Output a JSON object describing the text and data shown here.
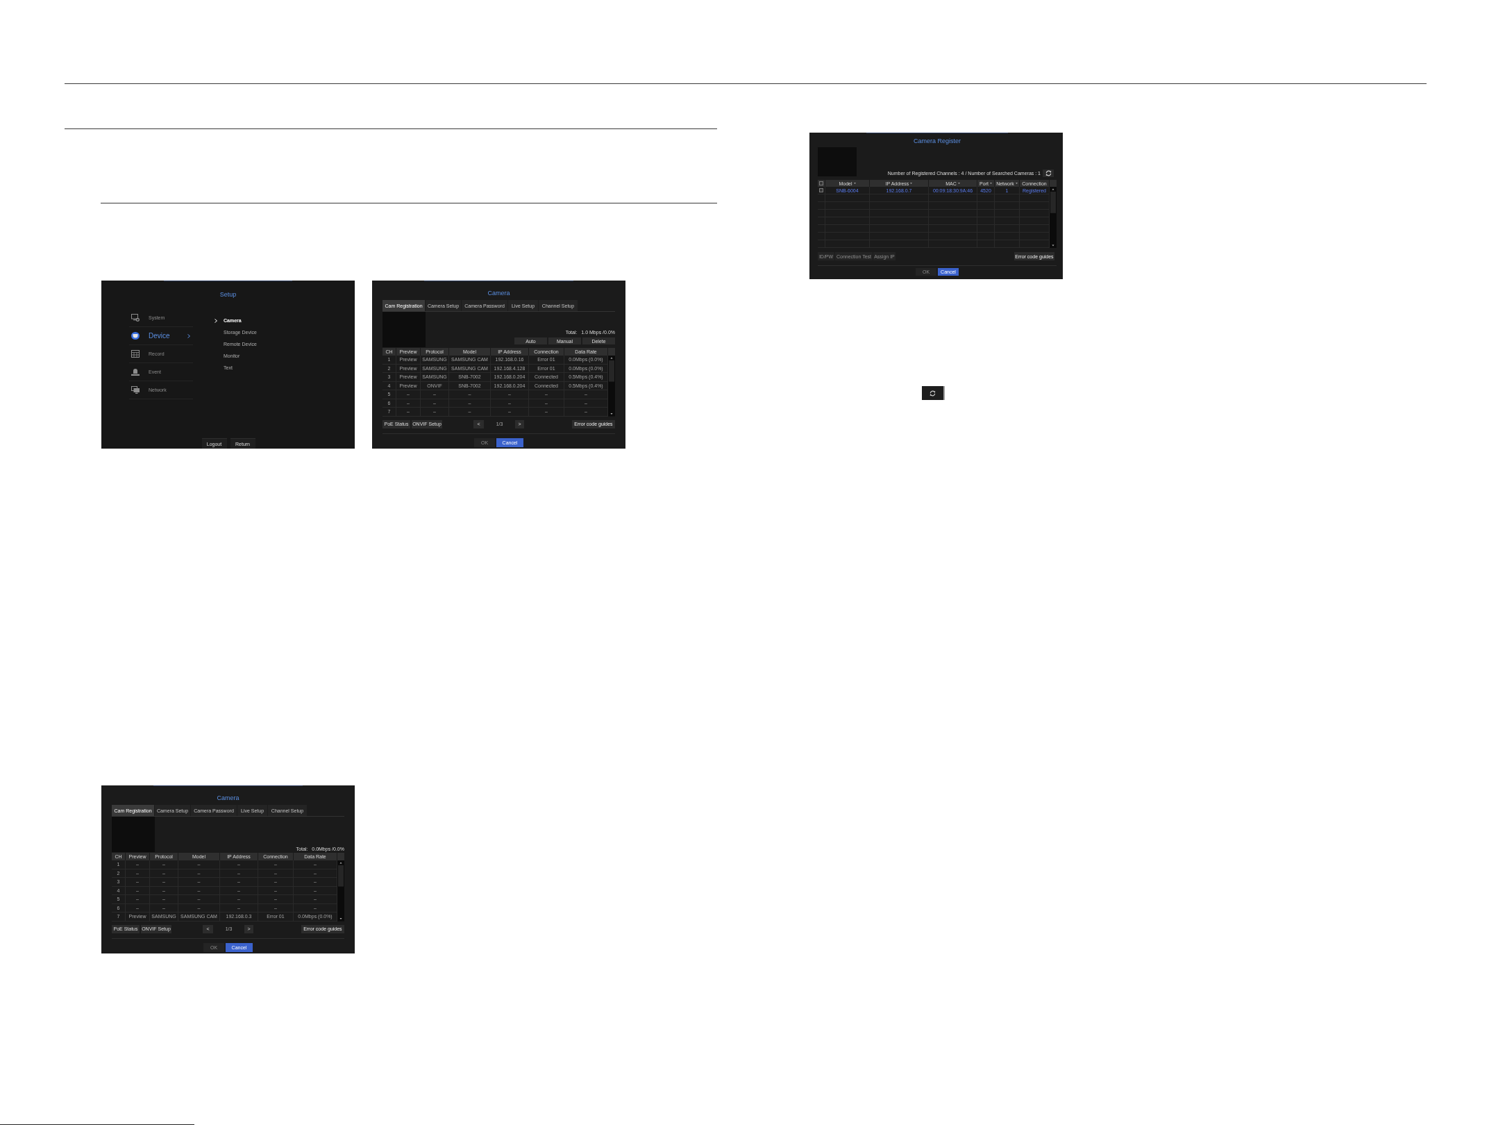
{
  "left_column": {
    "figure_row": [
      {
        "kind": "setup_menu",
        "title": "Setup",
        "menu": [
          {
            "label": "System",
            "selected": false
          },
          {
            "label": "Device",
            "selected": true
          },
          {
            "label": "Record",
            "selected": false
          },
          {
            "label": "Event",
            "selected": false
          },
          {
            "label": "Network",
            "selected": false
          }
        ],
        "submenu": [
          {
            "label": "Camera",
            "selected": true
          },
          {
            "label": "Storage Device",
            "selected": false
          },
          {
            "label": "Remote Device",
            "selected": false
          },
          {
            "label": "Monitor",
            "selected": false
          },
          {
            "label": "Text",
            "selected": false
          }
        ],
        "buttons": [
          "Logout",
          "Return"
        ]
      },
      {
        "kind": "camera",
        "title": "Camera",
        "tabs": [
          {
            "label": "Cam Registration",
            "selected": true
          },
          {
            "label": "Camera Setup",
            "selected": false
          },
          {
            "label": "Camera Password",
            "selected": false
          },
          {
            "label": "Live Setup",
            "selected": false
          },
          {
            "label": "Channel Setup",
            "selected": false
          }
        ],
        "total": {
          "label": "Total:",
          "value": "1.0 Mbps /0.0%"
        },
        "actions": [
          "Auto",
          "Manual",
          "Delete"
        ],
        "table": {
          "columns": [
            "CH",
            "Preview",
            "Protocol",
            "Model",
            "IP Address",
            "Connection",
            "Data Rate"
          ],
          "rows": [
            [
              "1",
              "Preview",
              "SAMSUNG",
              "SAMSUNG CAM",
              "192.168.0.16",
              "Error 01",
              "0.0Mbps (0.0%)"
            ],
            [
              "2",
              "Preview",
              "SAMSUNG",
              "SAMSUNG CAM",
              "192.168.4.128",
              "Error 01",
              "0.0Mbps (0.0%)"
            ],
            [
              "3",
              "Preview",
              "SAMSUNG",
              "SNB-7002",
              "192.168.0.204",
              "Connected",
              "0.5Mbps (0.4%)"
            ],
            [
              "4",
              "Preview",
              "ONVIF",
              "SNB-7002",
              "192.168.0.204",
              "Connected",
              "0.5Mbps (0.4%)"
            ],
            [
              "5",
              "–",
              "–",
              "–",
              "–",
              "–",
              "–"
            ],
            [
              "6",
              "–",
              "–",
              "–",
              "–",
              "–",
              "–"
            ],
            [
              "7",
              "–",
              "–",
              "–",
              "–",
              "–",
              "–"
            ]
          ]
        },
        "tools": [
          "PoE Status",
          "ONVIF Setup"
        ],
        "pager": {
          "previous": "<",
          "page": "1/3",
          "next": ">"
        },
        "help": "Error code guides",
        "dialog_buttons": [
          {
            "label": "OK",
            "disabled": true,
            "focused": false
          },
          {
            "label": "Cancel",
            "disabled": false,
            "focused": true
          }
        ]
      }
    ],
    "figure": {
      "kind": "camera",
      "title": "Camera",
      "tabs": [
        {
          "label": "Cam Registration",
          "selected": true
        },
        {
          "label": "Camera Setup",
          "selected": false
        },
        {
          "label": "Camera Password",
          "selected": false
        },
        {
          "label": "Live Setup",
          "selected": false
        },
        {
          "label": "Channel Setup",
          "selected": false
        }
      ],
      "total": {
        "label": "Total:",
        "value": "0.0Mbps /0.0%"
      },
      "table": {
        "columns": [
          "CH",
          "Preview",
          "Protocol",
          "Model",
          "IP Address",
          "Connection",
          "Data Rate"
        ],
        "rows": [
          [
            "1",
            "–",
            "–",
            "–",
            "–",
            "–",
            "–"
          ],
          [
            "2",
            "–",
            "–",
            "–",
            "–",
            "–",
            "–"
          ],
          [
            "3",
            "–",
            "–",
            "–",
            "–",
            "–",
            "–"
          ],
          [
            "4",
            "–",
            "–",
            "–",
            "–",
            "–",
            "–"
          ],
          [
            "5",
            "–",
            "–",
            "–",
            "–",
            "–",
            "–"
          ],
          [
            "6",
            "–",
            "–",
            "–",
            "–",
            "–",
            "–"
          ],
          [
            "7",
            "Preview",
            "SAMSUNG",
            "SAMSUNG CAM",
            "192.168.0.3",
            "Error 01",
            "0.0Mbps (0.0%)"
          ]
        ]
      },
      "tools": [
        "PoE Status",
        "ONVIF Setup"
      ],
      "pager": {
        "previous": "<",
        "page": "1/3",
        "next": ">"
      },
      "help": "Error code guides",
      "dialog_buttons": [
        {
          "label": "OK",
          "disabled": true,
          "focused": false
        },
        {
          "label": "Cancel",
          "disabled": false,
          "focused": true
        }
      ]
    }
  },
  "right_column": {
    "figure": {
      "kind": "camera_register",
      "title": "Camera Register",
      "summary": "Number of Registered Channels : 4 / Number of Searched Cameras : 1",
      "table": {
        "select_all": {
          "checked": false
        },
        "columns": [
          {
            "label": "Model",
            "sortable": true
          },
          {
            "label": "IP Address",
            "sortable": true
          },
          {
            "label": "MAC",
            "sortable": true
          },
          {
            "label": "Port",
            "sortable": true
          },
          {
            "label": "Network",
            "sortable": true
          },
          {
            "label": "Connection",
            "sortable": false
          }
        ],
        "rows": [
          {
            "checked": false,
            "highlighted": true,
            "cells": [
              "SNB-6004",
              "192.168.0.7",
              "00:09:18:30:9A:46",
              "4520",
              "1",
              "Registered"
            ]
          }
        ]
      },
      "tools": [
        {
          "label": "ID/PW",
          "disabled": true
        },
        {
          "label": "Connection Test",
          "disabled": true
        },
        {
          "label": "Assign IP",
          "disabled": true
        }
      ],
      "help": "Error code guides",
      "dialog_buttons": [
        {
          "label": "OK",
          "disabled": true,
          "focused": false
        },
        {
          "label": "Cancel",
          "disabled": false,
          "focused": true
        }
      ]
    },
    "inline_button": {
      "kind": "refresh"
    }
  }
}
